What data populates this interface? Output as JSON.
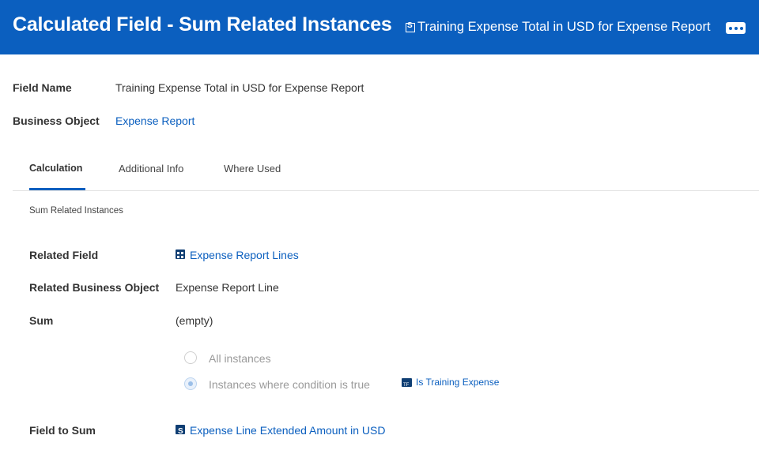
{
  "header": {
    "title": "Calculated Field - Sum Related Instances",
    "subtitle": "Training Expense Total in USD for Expense Report"
  },
  "fields": {
    "field_name_label": "Field Name",
    "field_name_value": "Training Expense Total in USD for Expense Report",
    "business_object_label": "Business Object",
    "business_object_value": "Expense Report"
  },
  "tabs": [
    {
      "label": "Calculation",
      "active": true
    },
    {
      "label": "Additional Info",
      "active": false
    },
    {
      "label": "Where Used",
      "active": false
    }
  ],
  "calculation": {
    "section_title": "Sum Related Instances",
    "related_field_label": "Related Field",
    "related_field_value": "Expense Report Lines",
    "related_bo_label": "Related Business Object",
    "related_bo_value": "Expense Report Line",
    "sum_label": "Sum",
    "sum_value": "(empty)",
    "options": [
      {
        "label": "All instances",
        "selected": false
      },
      {
        "label": "Instances where condition is true",
        "selected": true
      }
    ],
    "condition_link": "Is Training Expense",
    "field_to_sum_label": "Field to Sum",
    "field_to_sum_value": "Expense Line Extended Amount in USD"
  },
  "colors": {
    "header_bg": "#0b5fbf",
    "link": "#0b5fbf",
    "icon_dark": "#0f3e73"
  },
  "icons": {
    "header_field": "field-s-icon",
    "more": "more-icon",
    "related_field": "multi-instance-icon",
    "condition": "boolean-field-icon",
    "field_to_sum": "field-s-icon"
  }
}
